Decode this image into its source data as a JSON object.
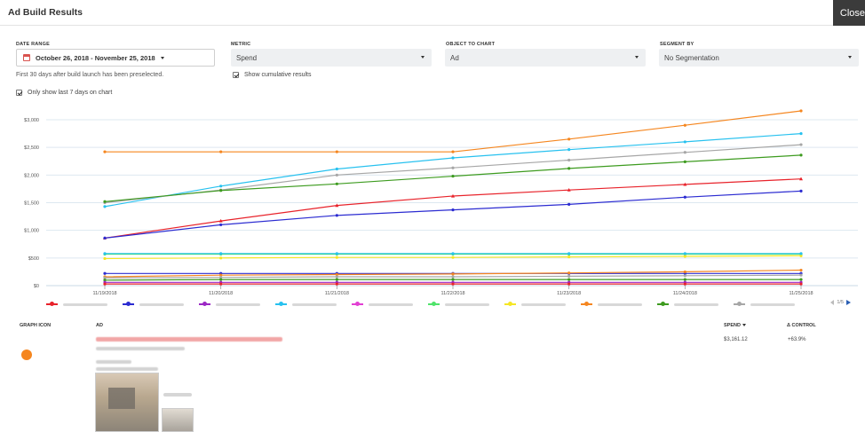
{
  "window": {
    "title": "Ad Build Results",
    "close_label": "Close"
  },
  "filters": {
    "date_range": {
      "label": "DATE RANGE",
      "value": "October 26, 2018 - November 25, 2018"
    },
    "metric": {
      "label": "METRIC",
      "value": "Spend"
    },
    "object": {
      "label": "OBJECT TO CHART",
      "value": "Ad"
    },
    "segment": {
      "label": "SEGMENT BY",
      "value": "No Segmentation"
    },
    "hint": "First 30 days after build launch has been preselected.",
    "cumulative_label": "Show cumulative results",
    "cumulative_checked": true,
    "last7_label": "Only show last 7 days on chart",
    "last7_checked": true
  },
  "chart_data": {
    "type": "line",
    "categories": [
      "11/19/2018",
      "11/20/2018",
      "11/21/2018",
      "11/22/2018",
      "11/23/2018",
      "11/24/2018",
      "11/25/2018"
    ],
    "y_ticks": [
      "$3,000",
      "$2,500",
      "$2,000",
      "$1,500",
      "$1,000",
      "$500",
      "$0"
    ],
    "ylim": [
      0,
      3000
    ],
    "grid": true,
    "series": [
      {
        "color": "#f5861f",
        "marker": "circle",
        "values": [
          2420,
          2420,
          2420,
          2420,
          2650,
          2900,
          3160
        ]
      },
      {
        "color": "#27c1ef",
        "marker": "circle",
        "values": [
          1430,
          1800,
          2110,
          2310,
          2460,
          2600,
          2750
        ]
      },
      {
        "color": "#a6a6a6",
        "marker": "circle",
        "values": [
          1500,
          1730,
          2000,
          2130,
          2270,
          2410,
          2550
        ]
      },
      {
        "color": "#3d9b1f",
        "marker": "circle",
        "values": [
          1520,
          1720,
          1840,
          1980,
          2120,
          2240,
          2360
        ]
      },
      {
        "color": "#e8222a",
        "marker": "triangle",
        "values": [
          860,
          1170,
          1450,
          1620,
          1730,
          1830,
          1930
        ]
      },
      {
        "color": "#2b2bd1",
        "marker": "circle",
        "values": [
          860,
          1100,
          1270,
          1370,
          1470,
          1600,
          1710
        ]
      },
      {
        "color": "#4fe36a",
        "marker": "circle",
        "values": [
          570,
          570,
          570,
          570,
          570,
          570,
          570
        ]
      },
      {
        "color": "#f5e624",
        "marker": "circle",
        "values": [
          490,
          500,
          510,
          510,
          520,
          530,
          540
        ]
      },
      {
        "color": "#27c1ef",
        "marker": "circle",
        "values": [
          580,
          580,
          580,
          580,
          580,
          580,
          580
        ]
      },
      {
        "color": "#2b2bd1",
        "marker": "circle",
        "values": [
          220,
          220,
          220,
          220,
          220,
          220,
          220
        ]
      },
      {
        "color": "#f5861f",
        "marker": "circle",
        "values": [
          160,
          190,
          200,
          210,
          230,
          250,
          280
        ]
      },
      {
        "color": "#a6a6a6",
        "marker": "circle",
        "values": [
          140,
          150,
          160,
          160,
          170,
          180,
          190
        ]
      },
      {
        "color": "#3d9b1f",
        "marker": "circle",
        "values": [
          100,
          110,
          110,
          110,
          110,
          110,
          110
        ]
      },
      {
        "color": "#9b27c4",
        "marker": "circle",
        "values": [
          60,
          60,
          60,
          60,
          60,
          60,
          60
        ]
      },
      {
        "color": "#e8222a",
        "marker": "circle",
        "values": [
          30,
          30,
          30,
          30,
          30,
          30,
          30
        ]
      }
    ],
    "legend_colors": [
      "#e8222a",
      "#2b2bd1",
      "#9b27c4",
      "#27c1ef",
      "#e23fd3",
      "#4fe36a",
      "#f5e624",
      "#f5861f",
      "#3d9b1f",
      "#a6a6a6"
    ],
    "pager": "1/5"
  },
  "table": {
    "headers": {
      "graph_icon": "GRAPH ICON",
      "ad": "AD",
      "spend": "SPEND",
      "control": "Δ CONTROL"
    },
    "rows": [
      {
        "dot_color": "#f5861f",
        "spend": "$3,161.12",
        "control": "+63.9%"
      }
    ]
  }
}
